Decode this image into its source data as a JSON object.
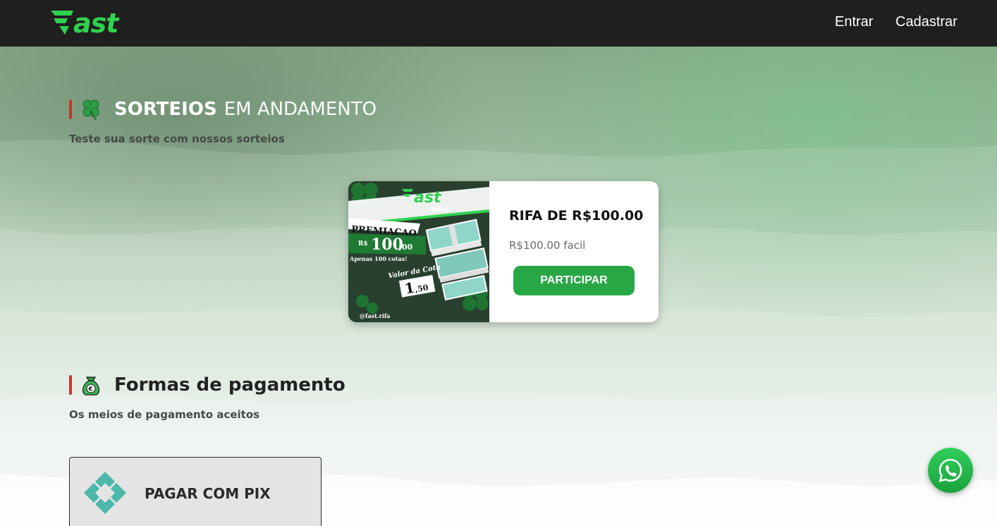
{
  "header": {
    "logo_text": "Fast",
    "nav": {
      "login": "Entrar",
      "register": "Cadastrar"
    }
  },
  "sorteios": {
    "title_strong": "SORTEIOS",
    "title_light": "EM ANDAMENTO",
    "subtitle": "Teste sua sorte com nossos sorteios",
    "icon": "clover-icon"
  },
  "raffle": {
    "title": "RIFA DE R$100.00",
    "description": "R$100.00 facil",
    "button": "PARTICIPAR",
    "image": {
      "brand": "Fast",
      "brand_sub": "RIFAS",
      "prize_label": "PREMIACAO",
      "prize_currency": "R$",
      "prize_value": "100",
      "prize_cents": ",00",
      "quota_note": "Apenas 100 cotas!",
      "quota_label": "Valor da Cota",
      "quota_value": "1",
      "quota_cents": ",50",
      "handle": "@fast.rifa"
    }
  },
  "pagamento": {
    "title": "Formas de pagamento",
    "subtitle": "Os meios de pagamento aceitos",
    "icon": "money-bag-icon",
    "methods": [
      {
        "label": "PAGAR COM PIX",
        "icon": "pix-icon"
      }
    ]
  },
  "whatsapp": {
    "icon": "whatsapp-icon"
  },
  "colors": {
    "header_bg": "#1f1f1f",
    "brand_green": "#2fd24f",
    "button_green": "#28a745",
    "accent_red": "#c0392b",
    "pix_teal": "#4bb8a9"
  }
}
